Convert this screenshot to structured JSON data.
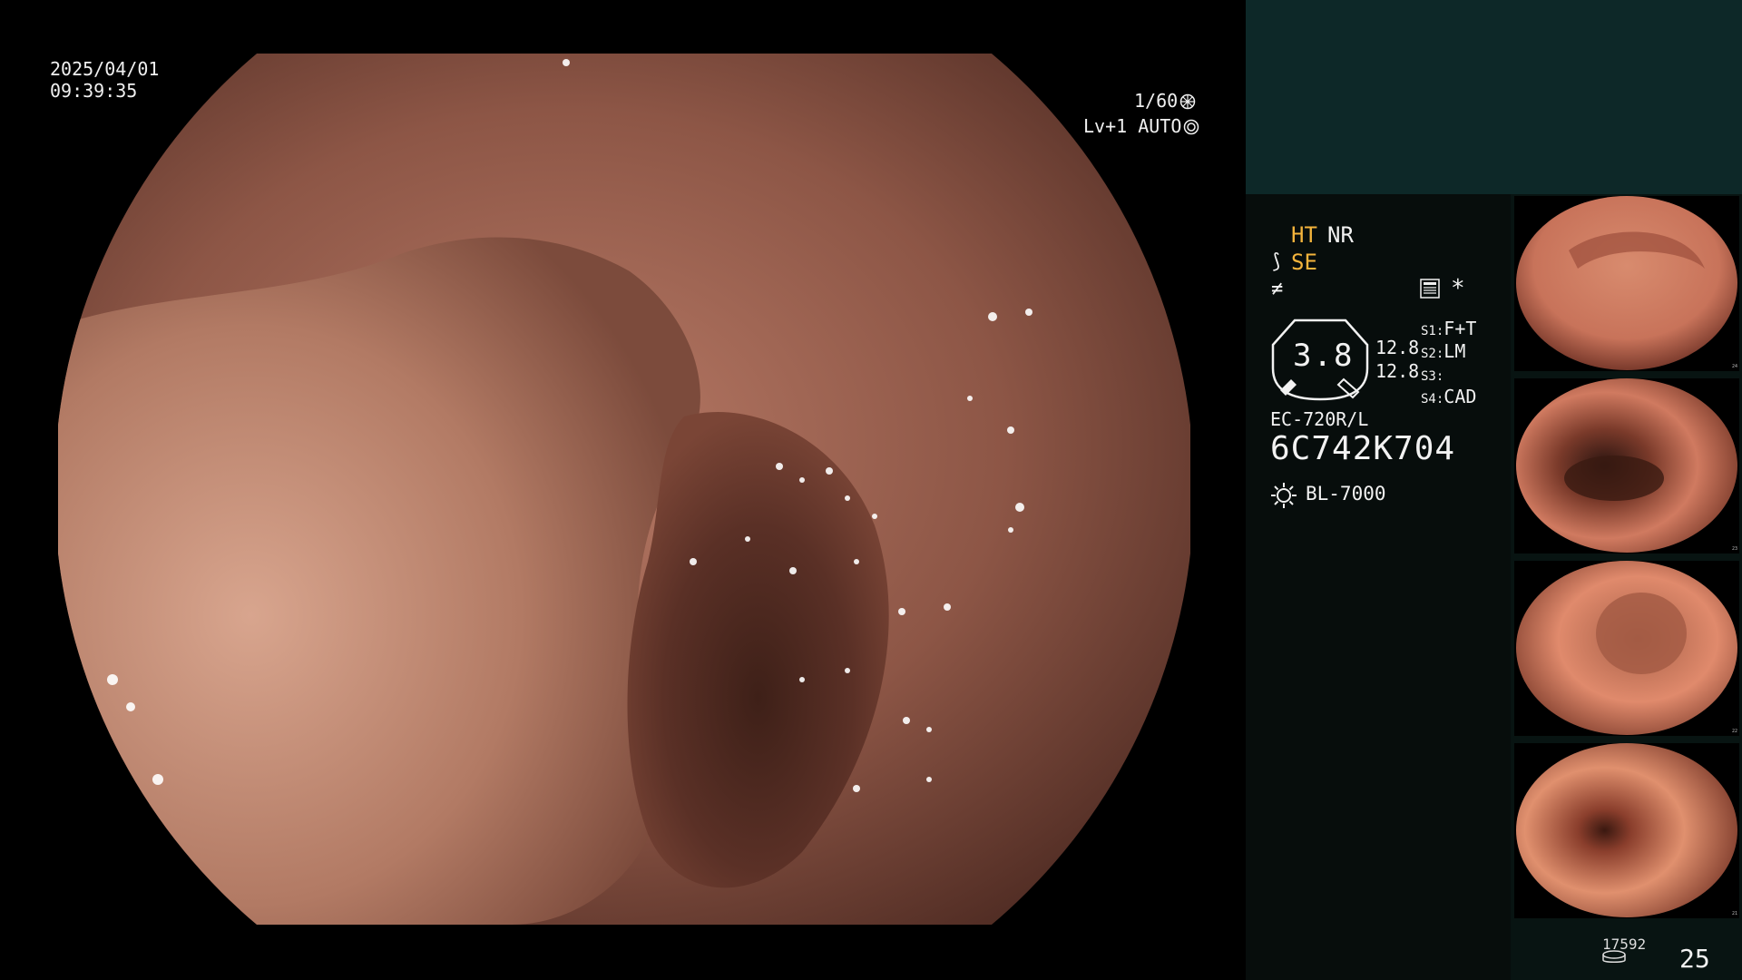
{
  "overlay": {
    "date": "2025/04/01",
    "time": "09:39:35",
    "shutter": "1/60",
    "level": "Lv+1 AUTO",
    "shutter_icon": "aperture-icon",
    "auto_icon": "iris-icon"
  },
  "sidebar": {
    "mode_ht": "HT",
    "mode_nr": "NR",
    "mode_se": "SE",
    "se_icon_glyph": "⟆",
    "signal_icon_glyph": "≠",
    "star": "*",
    "gauge_value": "3.8",
    "gauge_top": "12.8",
    "gauge_bottom": "12.8",
    "slots": [
      {
        "key": "S1:",
        "value": "F+T"
      },
      {
        "key": "S2:",
        "value": "LM"
      },
      {
        "key": "S3:",
        "value": ""
      },
      {
        "key": "S4:",
        "value": "CAD"
      }
    ],
    "scope_model": "EC-720R/L",
    "scope_serial": "6C742K704",
    "light_source": "BL-7000",
    "capture_count": "17592",
    "page_number": "25",
    "colors": {
      "accent_yellow": "#f4b43c",
      "panel_top": "#0d2828",
      "panel": "#070d0c"
    }
  },
  "thumbnails": [
    {
      "label": "capture-1",
      "index": "24"
    },
    {
      "label": "capture-2",
      "index": "23"
    },
    {
      "label": "capture-3",
      "index": "22"
    },
    {
      "label": "capture-4",
      "index": "21"
    }
  ]
}
